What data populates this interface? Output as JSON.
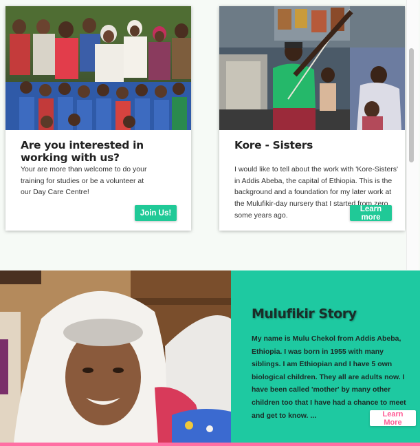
{
  "colors": {
    "accent_green": "#20c997",
    "story_panel": "#1ec9a1",
    "pink_strip": "#ff6fa3",
    "learn_more_text": "#ff5b95"
  },
  "cards": [
    {
      "title": "Are you interested in working with us?",
      "text": "Your are more than welcome to do your training for studies or be a volunteer at our Day Care Centre!",
      "button": "Join Us!",
      "image": "group-of-women-and-children-photo"
    },
    {
      "title": "Kore - Sisters",
      "text": "I would like to tell about the work with 'Kore-Sisters' in Addis Abeba, the capital of Ethiopia. This is the background and a foundation for my later work at the Mulufikir-day nursery that I started from zero some years ago.",
      "button": "Learn more",
      "image": "woman-spinning-yarn-photo"
    }
  ],
  "story": {
    "title": "Mulufikir Story",
    "text": "My name is Mulu Chekol from Addis Abeba, Ethiopia. I was born in 1955 with many siblings. I am Ethiopian and I have 5 own biological children. They all are adults now. I have been called 'mother' by many other children too that I have had a chance to meet and get to know. ...",
    "button": "Learn More",
    "image": "smiling-woman-in-white-shawl-photo"
  }
}
